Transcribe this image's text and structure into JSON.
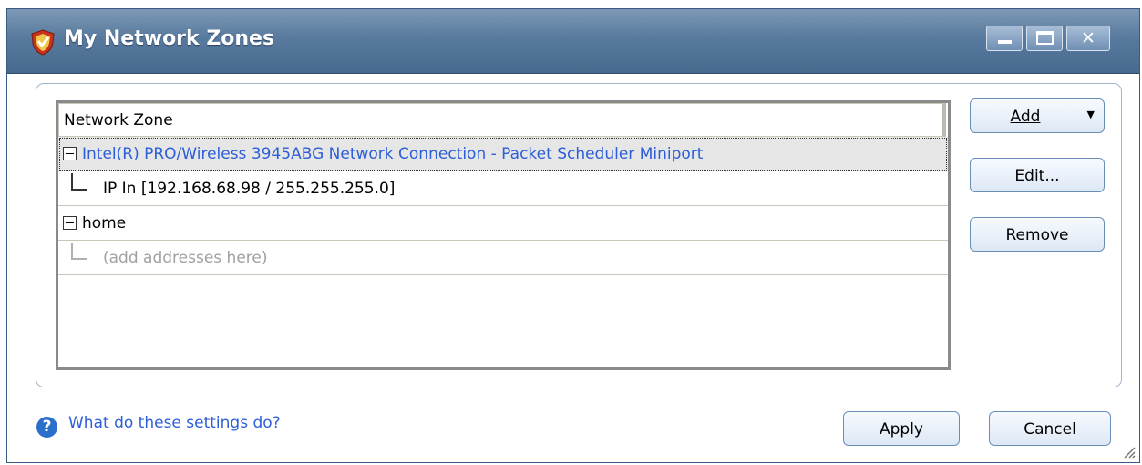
{
  "window": {
    "title": "My Network Zones",
    "min_glyph": "",
    "max_glyph": "",
    "close_glyph": "✕"
  },
  "table": {
    "column_header": "Network Zone",
    "rows": [
      {
        "type": "zone",
        "label": "Intel(R) PRO/Wireless 3945ABG Network Connection - Packet Scheduler Miniport",
        "selected": true
      },
      {
        "type": "address",
        "label": "IP In [192.168.68.98 / 255.255.255.0]"
      },
      {
        "type": "zone",
        "label": "home",
        "selected": false
      },
      {
        "type": "placeholder",
        "label": "(add addresses here)"
      }
    ]
  },
  "buttons": {
    "add": "Add",
    "add_arrow": "▼",
    "edit": "Edit...",
    "remove": "Remove",
    "apply": "Apply",
    "cancel": "Cancel"
  },
  "footer": {
    "help_icon": "?",
    "help_link": "What do these settings do?"
  },
  "colors": {
    "title_bar": "#587a9e",
    "link": "#2c5ed8",
    "placeholder_text": "#a0a0a0",
    "selected_row": "#e6e6e6"
  },
  "icons": [
    "shield-app-icon",
    "minimize-icon",
    "maximize-icon",
    "close-icon",
    "collapse-icon",
    "help-icon",
    "resize-grip-icon"
  ]
}
